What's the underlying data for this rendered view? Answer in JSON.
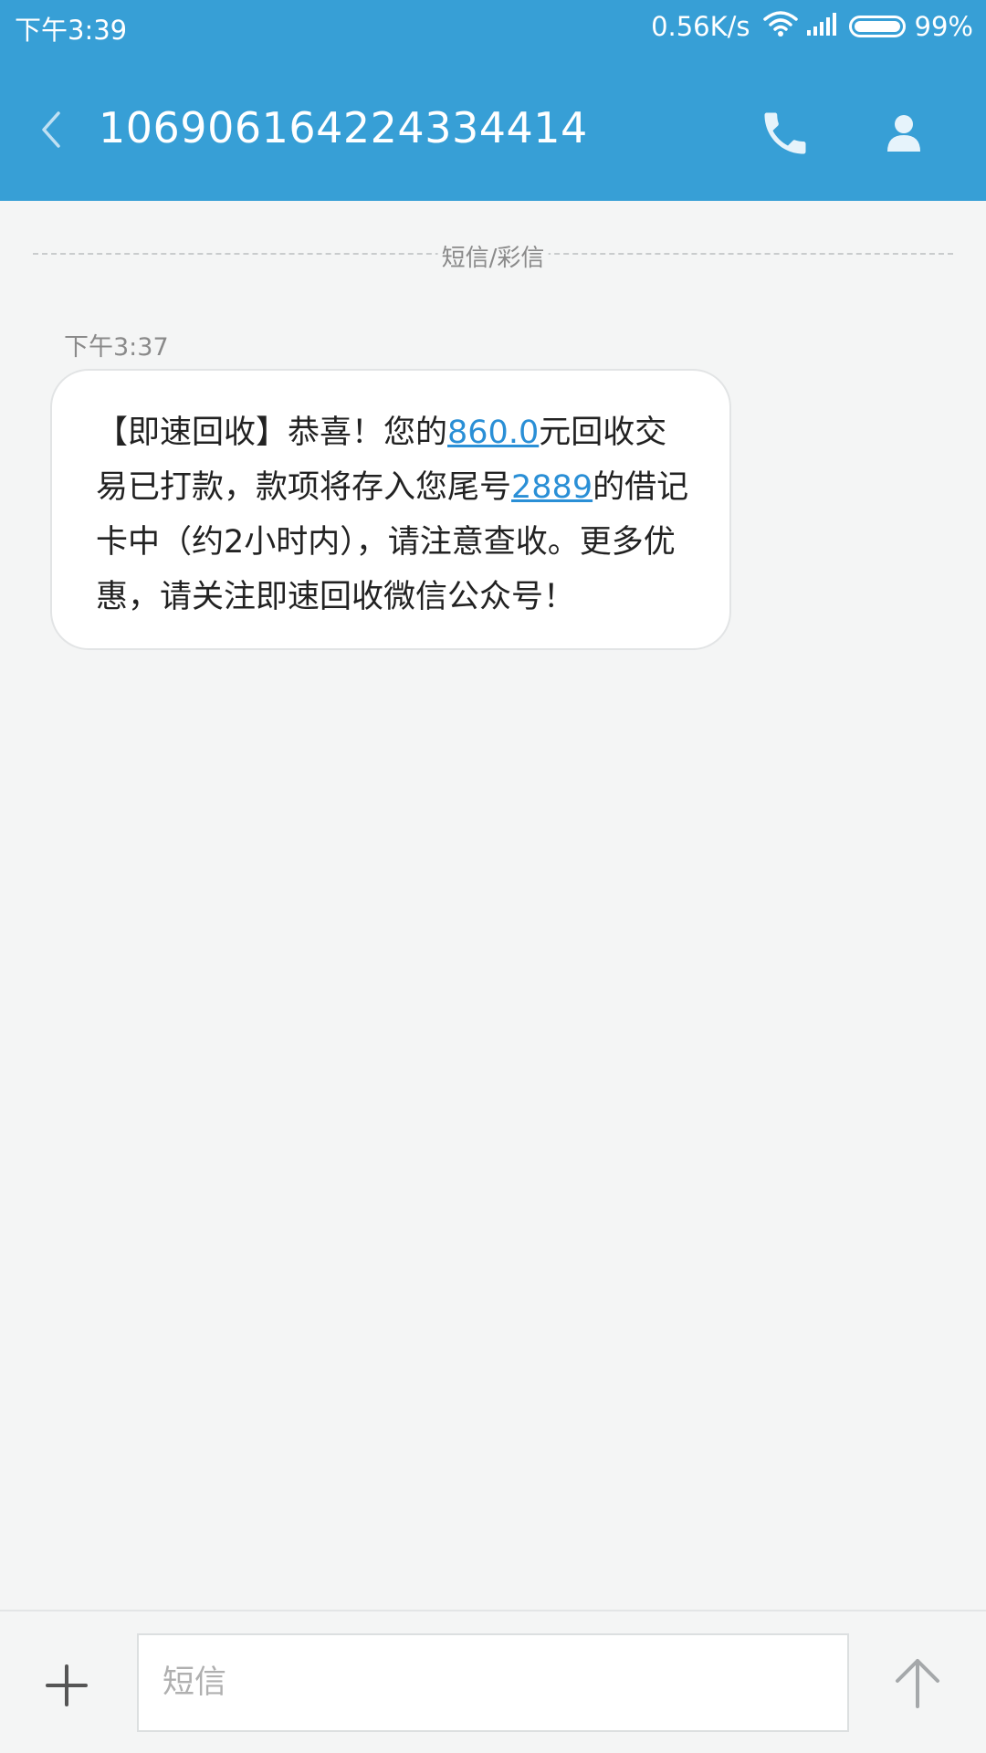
{
  "status_bar": {
    "time": "下午3:39",
    "net_speed": "0.56K/s",
    "battery_percent": "99%",
    "battery_level": 0.99
  },
  "header": {
    "title": "106906164224334414",
    "back_icon": "chevron-left-icon",
    "call_icon": "phone-icon",
    "contact_icon": "person-icon"
  },
  "conversation": {
    "divider_label": "短信/彩信",
    "message": {
      "time": "下午3:37",
      "part1": "【即速回收】恭喜！您的",
      "amount": "860.0",
      "part2": "元回收交易已打款，款项将存入您尾号",
      "card_suffix": "2889",
      "part3": "的借记卡中（约2小时内），请注意查收。更多优惠，请关注即速回收微信公众号！"
    }
  },
  "composer": {
    "placeholder": "短信",
    "add_icon": "plus-icon",
    "send_icon": "send-arrow-icon"
  },
  "colors": {
    "accent": "#379fd6",
    "link": "#2a8fd6",
    "background": "#f4f5f5"
  }
}
